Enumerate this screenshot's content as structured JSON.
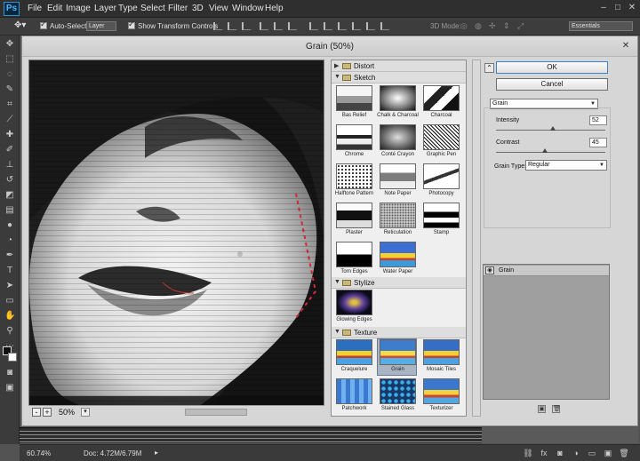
{
  "app": {
    "logo": "Ps"
  },
  "menu": [
    "File",
    "Edit",
    "Image",
    "Layer",
    "Type",
    "Select",
    "Filter",
    "3D",
    "View",
    "Window",
    "Help"
  ],
  "window_controls": {
    "minimize": "–",
    "maximize": "□",
    "close": "✕"
  },
  "options_bar": {
    "auto_select_label": "Auto-Select:",
    "auto_select_value": "Layer",
    "show_transform_label": "Show Transform Controls",
    "mode_3d_label": "3D Mode:",
    "workspace": "Essentials"
  },
  "dialog": {
    "title": "Grain (50%)",
    "close": "✕",
    "zoom": "50%",
    "zoom_out": "-",
    "zoom_in": "+",
    "zoom_arrow": "▾",
    "gallery": {
      "categories": [
        {
          "name": "Distort",
          "expanded": false
        },
        {
          "name": "Sketch",
          "expanded": true,
          "filters": [
            "Bas Relief",
            "Chalk & Charcoal",
            "Charcoal",
            "Chrome",
            "Conté Crayon",
            "Graphic Pen",
            "Halftone Pattern",
            "Note Paper",
            "Photocopy",
            "Plaster",
            "Reticulation",
            "Stamp",
            "Torn Edges",
            "Water Paper"
          ]
        },
        {
          "name": "Stylize",
          "expanded": true,
          "filters": [
            "Glowing Edges"
          ]
        },
        {
          "name": "Texture",
          "expanded": true,
          "filters": [
            "Craquelure",
            "Grain",
            "Mosaic Tiles",
            "Patchwork",
            "Stained Glass",
            "Texturizer"
          ]
        }
      ],
      "selected_filter": "Grain",
      "collapse_glyph": "⌃"
    },
    "ok_label": "OK",
    "cancel_label": "Cancel",
    "filter_select": "Grain",
    "params": {
      "intensity_label": "Intensity",
      "intensity_value": "52",
      "intensity_max": 100,
      "contrast_label": "Contrast",
      "contrast_value": "45",
      "contrast_max": 100,
      "grain_type_label": "Grain Type:",
      "grain_type_value": "Regular"
    },
    "effect_layers": [
      {
        "name": "Grain",
        "visible": true
      }
    ],
    "eye_glyph": "◉",
    "new_layer_glyph": "▣",
    "delete_layer_glyph": "🗑"
  },
  "status": {
    "zoom": "60.74%",
    "doc": "Doc: 4.72M/6.79M",
    "arrow": "▸"
  },
  "colors": {
    "accent": "#3b84c9",
    "chrome": "#3b3b3b",
    "dialog_bg": "#d6d6d6"
  }
}
